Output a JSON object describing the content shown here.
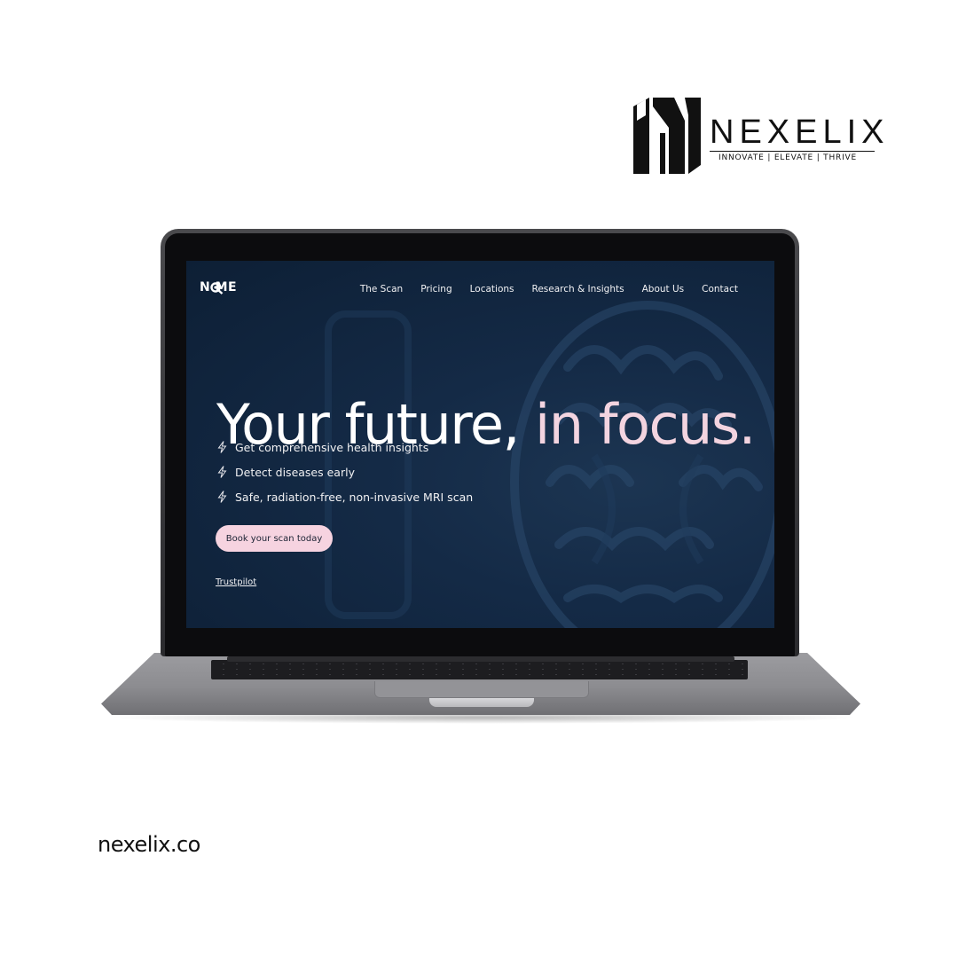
{
  "brand": {
    "name": "NEXELIX",
    "tagline": "INNOVATE | ELEVATE | THRIVE",
    "logo_icon": "nexelix-n-logo"
  },
  "site": {
    "logo_text": "N   ME",
    "logo_icon": "magnifier-glyph",
    "nav": [
      "The Scan",
      "Pricing",
      "Locations",
      "Research & Insights",
      "About Us",
      "Contact"
    ],
    "headline": {
      "main": "Your future, ",
      "accent": "in focus."
    },
    "features": [
      "Get comprehensive health insights",
      "Detect diseases early",
      "Safe, radiation-free, non-invasive MRI scan"
    ],
    "feature_icon": "lightning-bolt-icon",
    "cta_label": "Book your scan today",
    "trust_link": "Trustpilot",
    "colors": {
      "background": "#0d1f35",
      "accent_text": "#f3d4e0",
      "cta_background": "#f6d3e0"
    }
  },
  "footer": {
    "url": "nexelix.co"
  }
}
